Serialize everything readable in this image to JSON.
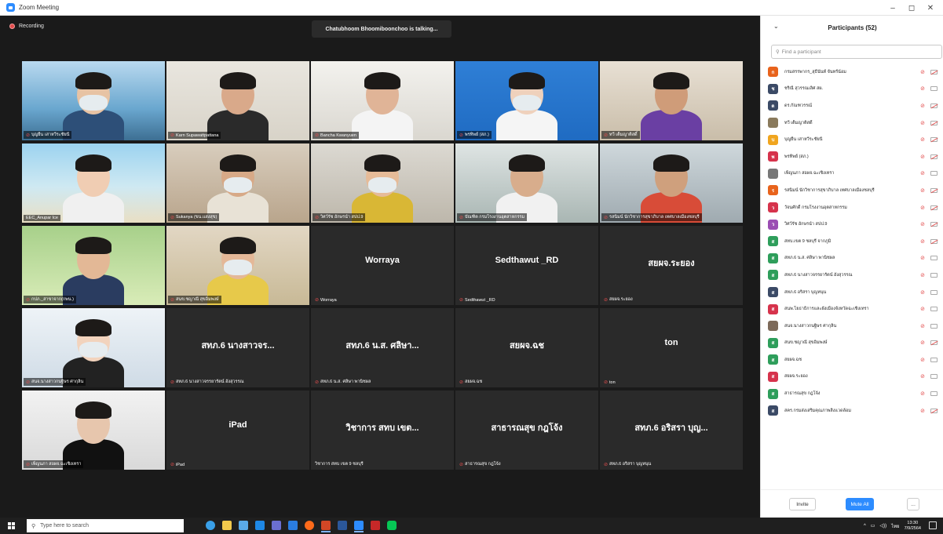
{
  "window": {
    "title": "Zoom Meeting",
    "controls": {
      "minimize": "–",
      "maximize": "◻",
      "close": "✕"
    }
  },
  "meeting": {
    "recording_label": "Recording",
    "talking_label": "Chatubhoom Bhoomiboonchoo is talking...",
    "tiles": [
      {
        "name": "บุญยืน เสาหวีระชัยนี",
        "big": "",
        "video": true,
        "muted": true
      },
      {
        "name": "Karn Supawattpattana",
        "big": "",
        "video": true,
        "muted": true
      },
      {
        "name": "Bancha Kwanyuen",
        "big": "",
        "video": true,
        "muted": true
      },
      {
        "name": "พรทิพย์ (สภ.)",
        "big": "",
        "video": true,
        "muted": true
      },
      {
        "name": "ทวี เต็มญาติสดิ์",
        "big": "",
        "video": true,
        "muted": true
      },
      {
        "name": "EEC_Anupar Ice",
        "big": "",
        "video": true,
        "muted": false
      },
      {
        "name": "Sukanya (ขน.แสงสุข)",
        "big": "",
        "video": true,
        "muted": true
      },
      {
        "name": "วิศว์รัช อักษรนำ สปป.9",
        "big": "",
        "video": true,
        "muted": true
      },
      {
        "name": "บัณฑิต กรมโรงงานอุตสาหกรรม",
        "big": "",
        "video": true,
        "muted": true
      },
      {
        "name": "รสนิมน์ นักวิชาการสุขาภิบาล เทศบาลเมืองชลบุรี",
        "big": "",
        "video": true,
        "muted": true
      },
      {
        "name": "กปภ._สาขาจาก(กพน.)",
        "big": "",
        "video": true,
        "muted": true
      },
      {
        "name": "สนข.ชญาณี สุขอิ่มพงษ์",
        "big": "",
        "video": true,
        "muted": true
      },
      {
        "name": "Worraya",
        "big": "Worraya",
        "video": false,
        "muted": true
      },
      {
        "name": "Sedthawut _RD",
        "big": "Sedthawut _RD",
        "video": false,
        "muted": true
      },
      {
        "name": "สยผจ.ระยอง",
        "big": "สยผจ.ระยอง",
        "video": false,
        "muted": true
      },
      {
        "name": "สนจ.นางสาวกนฐิษร ศากุลิน",
        "big": "",
        "video": true,
        "muted": true
      },
      {
        "name": "สทภ.6 นางสาวจรรยารัตน์ อังสุวรรณ",
        "big": "สทภ.6 นางสาวจร...",
        "video": false,
        "muted": true
      },
      {
        "name": "สทภ.6 น.ส. ศลิษา พานิชผล",
        "big": "สทภ.6 น.ส. ศลิษา...",
        "video": false,
        "muted": true
      },
      {
        "name": "สยผจ.ฉช",
        "big": "สยผจ.ฉช",
        "video": false,
        "muted": true
      },
      {
        "name": "ton",
        "big": "ton",
        "video": false,
        "muted": true
      },
      {
        "name": "เพ็ญนภา สอผจ.ฉะเชิงเทรา",
        "big": "",
        "video": true,
        "muted": true
      },
      {
        "name": "iPad",
        "big": "iPad",
        "video": false,
        "muted": true
      },
      {
        "name": "วิชาการ สทบ เขต 9 ชลบุรี",
        "big": "วิชาการ สทบ เขต...",
        "video": false,
        "muted": false
      },
      {
        "name": "สาธารณสุข กฎโจ้ง",
        "big": "สาธารณสุข กฎโจ้ง",
        "video": false,
        "muted": true
      },
      {
        "name": "สทภ.6 อริสรา บุญหนุน",
        "big": "สทภ.6 อริสรา บุญ...",
        "video": false,
        "muted": true
      }
    ]
  },
  "participants": {
    "title": "Participants (52)",
    "search_placeholder": "Find a participant",
    "list": [
      {
        "initial": "ก",
        "name": "กรมสรรพากร_สุธีนันท์ จันทร์น้อม",
        "color": "#e8631c",
        "video_off": true
      },
      {
        "initial": "ช",
        "name": "ชริณี สุวรรณเลิศ สผ.",
        "color": "#3b4a66",
        "video_off": false
      },
      {
        "initial": "ด",
        "name": "ดร.กัณฑวรรณ์",
        "color": "#3b4a66",
        "video_off": true
      },
      {
        "initial": "",
        "name": "ทวี เต็มญาติสดิ์",
        "color": "#8a7a5c",
        "video_off": true
      },
      {
        "initial": "บ",
        "name": "บุญยืน เสาหวีระชัยนี",
        "color": "#f0a51e",
        "video_off": true
      },
      {
        "initial": "พ",
        "name": "พรทิพย์ (สภ.)",
        "color": "#d6334c",
        "video_off": true
      },
      {
        "initial": "",
        "name": "เพ็ญนภา สอผจ.ฉะเชิงเทรา",
        "color": "#777777",
        "video_off": false
      },
      {
        "initial": "ร",
        "name": "รสนิมน์ นักวิชาการสุขาภิบาล เทศบาลเมืองชลบุรี",
        "color": "#e8631c",
        "video_off": true
      },
      {
        "initial": "ว",
        "name": "วัจนศักดิ์ กรมโรงงานอุตสาหกรรม",
        "color": "#d6334c",
        "video_off": true
      },
      {
        "initial": "ว",
        "name": "วิศว์รัช อักษรนำ สปป.9",
        "color": "#9b4db3",
        "video_off": true
      },
      {
        "initial": "ส",
        "name": "สทบ.เขต 9 ชลบุรี จากภูมิ",
        "color": "#2e9e5b",
        "video_off": true
      },
      {
        "initial": "ส",
        "name": "สทภ.6 น.ส. ศลิษา พานิชผล",
        "color": "#2e9e5b",
        "video_off": false
      },
      {
        "initial": "ส",
        "name": "สทภ.6 นางสาวจรรยารัตน์ อังสุวรรณ",
        "color": "#2e9e5b",
        "video_off": false
      },
      {
        "initial": "ส",
        "name": "สทภ.6 อริสรา บุญหนุน",
        "color": "#3b4a66",
        "video_off": false
      },
      {
        "initial": "ส",
        "name": "สนพ.โยธาธิการและผังเมืองจังหวัดฉะเชิงเทรา",
        "color": "#d6334c",
        "video_off": false
      },
      {
        "initial": "",
        "name": "สนจ.นางสาวกนฐิษร ศากุลิน",
        "color": "#7d6a5a",
        "video_off": false
      },
      {
        "initial": "ส",
        "name": "สนข.ชญาณี สุขอิ่มพงษ์",
        "color": "#2e9e5b",
        "video_off": true
      },
      {
        "initial": "ส",
        "name": "สยผจ.ฉช",
        "color": "#2e9e5b",
        "video_off": false
      },
      {
        "initial": "ส",
        "name": "สยผจ.ระยอง",
        "color": "#d6334c",
        "video_off": false
      },
      {
        "initial": "ส",
        "name": "สาธารณสุข กฎโจ้ง",
        "color": "#2e9e5b",
        "video_off": false
      },
      {
        "initial": "ส",
        "name": "สคร.กรมส่งเสริมคุณภาพสิ่งแวดล้อม",
        "color": "#3b4a66",
        "video_off": true
      }
    ],
    "invite_label": "Invite",
    "mute_all_label": "Mute All",
    "more_label": "..."
  },
  "taskbar": {
    "search_placeholder": "Type here to search",
    "time": "13:30",
    "date": "7/9/2564",
    "lang": "ไทย"
  }
}
